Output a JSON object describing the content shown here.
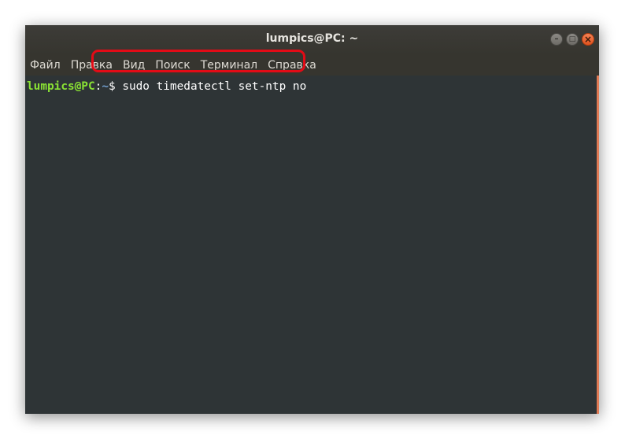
{
  "window": {
    "title": "lumpics@PC: ~"
  },
  "window_controls": {
    "minimize_glyph": "–",
    "maximize_glyph": "□",
    "close_glyph": "×"
  },
  "menubar": {
    "items": [
      "Файл",
      "Правка",
      "Вид",
      "Поиск",
      "Терминал",
      "Справка"
    ]
  },
  "terminal": {
    "user_host": "lumpics@PC",
    "separator": ":",
    "path": "~",
    "prompt_symbol": "$ ",
    "command": "sudo timedatectl set-ntp no"
  },
  "colors": {
    "terminal_bg": "#2e3436",
    "user_host": "#8ae234",
    "path": "#729fcf",
    "highlight": "#e30b16",
    "close_button": "#e0521e"
  }
}
